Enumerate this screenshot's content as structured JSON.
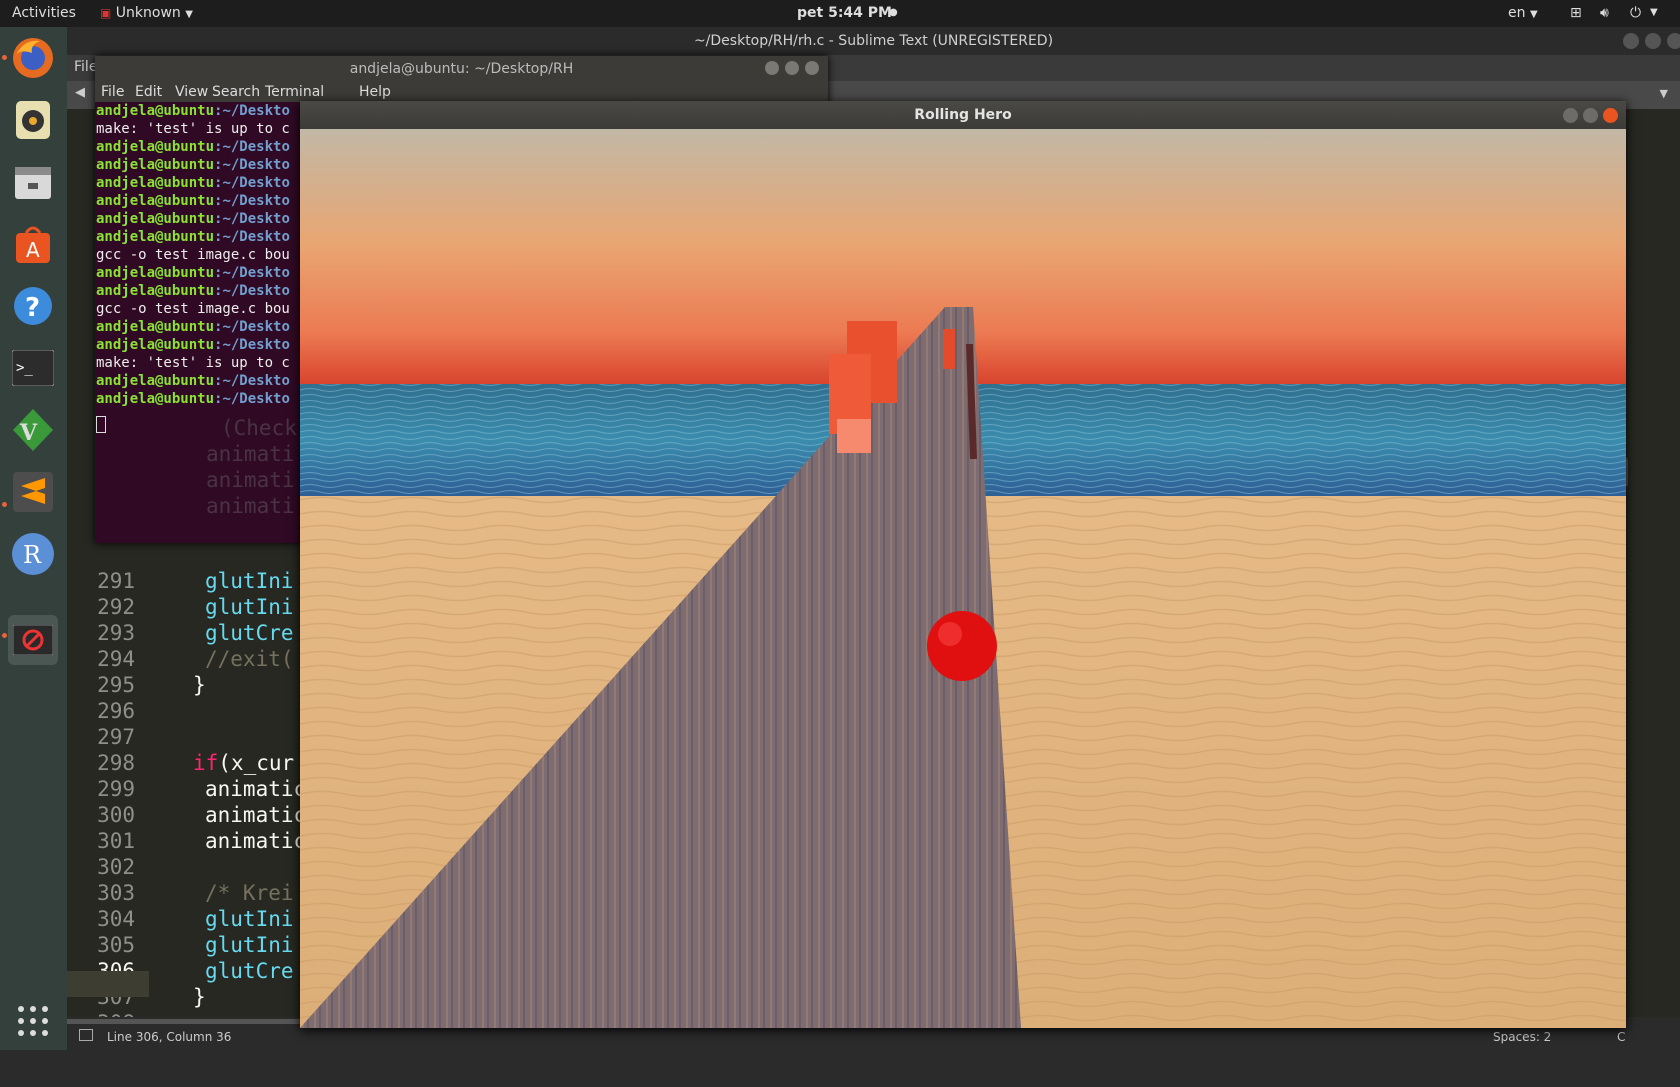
{
  "topbar": {
    "activities": "Activities",
    "app_menu": "Unknown",
    "clock": "pet  5:44 PM",
    "lang": "en"
  },
  "sublime": {
    "title": "~/Desktop/RH/rh.c - Sublime Text (UNREGISTERED)",
    "menu_file": "File",
    "lines": [
      {
        "n": "291",
        "text": "glutIni",
        "color": "#66d9ef",
        "indent": 1
      },
      {
        "n": "292",
        "text": "glutIni",
        "color": "#66d9ef",
        "indent": 1
      },
      {
        "n": "293",
        "text": "glutCre",
        "color": "#66d9ef",
        "indent": 1
      },
      {
        "n": "294",
        "text": "//exit(",
        "color": "#75715e",
        "indent": 1
      },
      {
        "n": "295",
        "text": "}",
        "color": "#f8f8f2",
        "indent": 0
      },
      {
        "n": "296",
        "text": "",
        "color": "#f8f8f2",
        "indent": 0
      },
      {
        "n": "297",
        "text": "",
        "color": "#f8f8f2",
        "indent": 0
      },
      {
        "n": "298",
        "text": "if(x_cur",
        "color": "#f8f8f2",
        "indent": 0
      },
      {
        "n": "299",
        "text": "animatic",
        "color": "#f8f8f2",
        "indent": 1
      },
      {
        "n": "300",
        "text": "animatic",
        "color": "#f8f8f2",
        "indent": 1
      },
      {
        "n": "301",
        "text": "animatic",
        "color": "#f8f8f2",
        "indent": 1
      },
      {
        "n": "302",
        "text": "",
        "color": "#f8f8f2",
        "indent": 1
      },
      {
        "n": "303",
        "text": "/* Krei",
        "color": "#75715e",
        "indent": 1
      },
      {
        "n": "304",
        "text": "glutIni",
        "color": "#66d9ef",
        "indent": 1
      },
      {
        "n": "305",
        "text": "glutIni",
        "color": "#66d9ef",
        "indent": 1
      },
      {
        "n": "306",
        "text": "glutCre",
        "color": "#66d9ef",
        "indent": 1
      },
      {
        "n": "307",
        "text": "}",
        "color": "#f8f8f2",
        "indent": 0
      },
      {
        "n": "308",
        "text": "",
        "color": "#f8f8f2",
        "indent": 0
      }
    ],
    "hidden_lines": [
      "(Check",
      "animati",
      "animati",
      "animati"
    ],
    "status_left": "Line 306, Column 36",
    "status_spaces": "Spaces: 2",
    "status_syntax": "C"
  },
  "terminal": {
    "title": "andjela@ubuntu: ~/Desktop/RH",
    "menu": [
      "File",
      "Edit",
      "View",
      "Search",
      "Terminal",
      "Help"
    ],
    "prompt": "andjela@ubuntu",
    "path": ":~/Deskto",
    "lines": [
      {
        "type": "prompt"
      },
      {
        "type": "text",
        "text": "make: 'test' is up to c"
      },
      {
        "type": "prompt"
      },
      {
        "type": "prompt"
      },
      {
        "type": "prompt"
      },
      {
        "type": "prompt"
      },
      {
        "type": "prompt"
      },
      {
        "type": "prompt"
      },
      {
        "type": "text",
        "text": "gcc -o test image.c bou"
      },
      {
        "type": "prompt"
      },
      {
        "type": "prompt"
      },
      {
        "type": "text",
        "text": "gcc -o test image.c bou"
      },
      {
        "type": "prompt"
      },
      {
        "type": "prompt"
      },
      {
        "type": "text",
        "text": "make: 'test' is up to c"
      },
      {
        "type": "prompt"
      },
      {
        "type": "prompt"
      }
    ]
  },
  "game": {
    "title": "Rolling Hero"
  },
  "dock": {
    "icons": [
      "firefox-icon",
      "rhythmbox-icon",
      "files-icon",
      "software-center-icon",
      "help-icon",
      "terminal-icon",
      "vim-icon",
      "sublime-text-icon",
      "r-icon",
      "rolling-hero-icon"
    ],
    "show_apps": "show-applications-icon"
  },
  "colors": {
    "sky_top": "#c2b7a3",
    "sky_bottom": "#ec6a4a",
    "sea": "#3a84a7",
    "sand": "#e4b57f",
    "bridge": "#7e6e72",
    "ball": "#e01010"
  }
}
